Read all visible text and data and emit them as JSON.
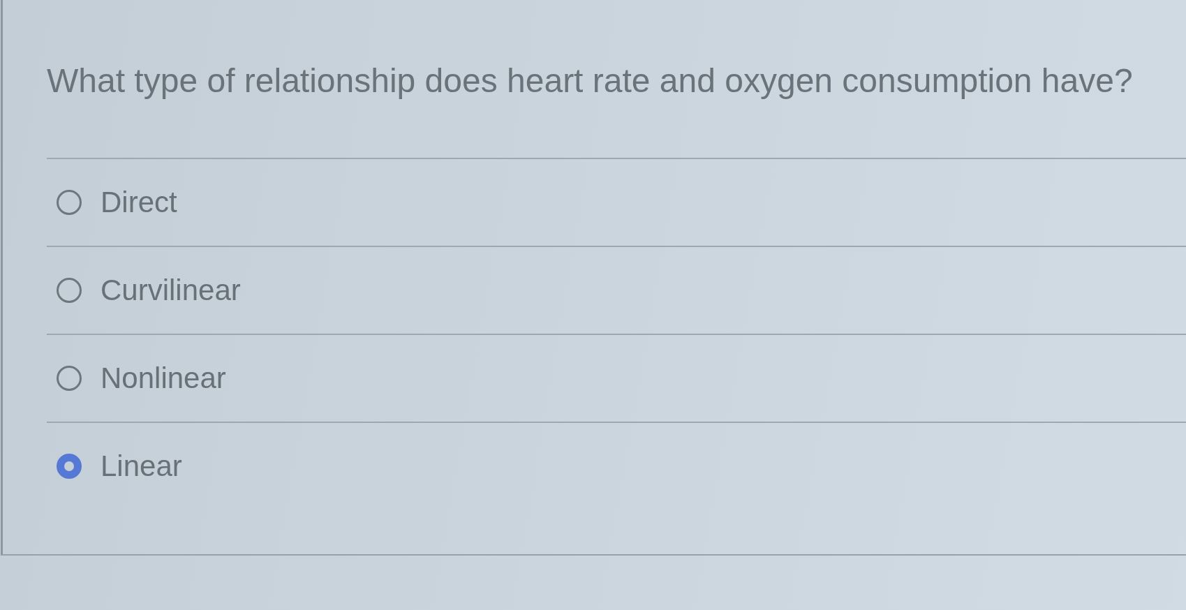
{
  "question": {
    "text": "What type of relationship does heart rate and oxygen consumption have?"
  },
  "options": [
    {
      "label": "Direct",
      "selected": false
    },
    {
      "label": "Curvilinear",
      "selected": false
    },
    {
      "label": "Nonlinear",
      "selected": false
    },
    {
      "label": "Linear",
      "selected": true
    }
  ]
}
